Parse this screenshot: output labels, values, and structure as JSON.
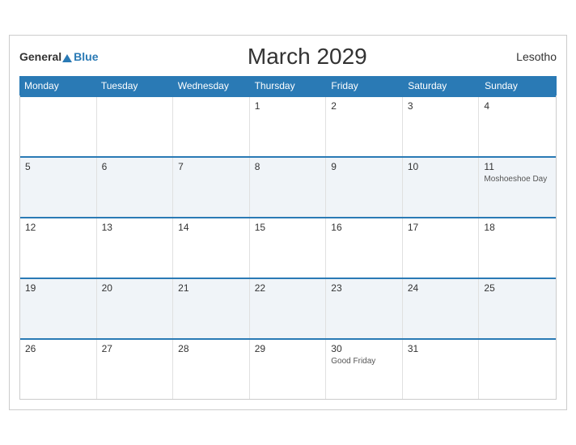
{
  "header": {
    "title": "March 2029",
    "country": "Lesotho",
    "logo_general": "General",
    "logo_blue": "Blue"
  },
  "days_of_week": [
    "Monday",
    "Tuesday",
    "Wednesday",
    "Thursday",
    "Friday",
    "Saturday",
    "Sunday"
  ],
  "weeks": [
    [
      {
        "day": "",
        "holiday": "",
        "empty": true
      },
      {
        "day": "",
        "holiday": "",
        "empty": true
      },
      {
        "day": "",
        "holiday": "",
        "empty": true
      },
      {
        "day": "1",
        "holiday": ""
      },
      {
        "day": "2",
        "holiday": ""
      },
      {
        "day": "3",
        "holiday": ""
      },
      {
        "day": "4",
        "holiday": ""
      }
    ],
    [
      {
        "day": "5",
        "holiday": ""
      },
      {
        "day": "6",
        "holiday": ""
      },
      {
        "day": "7",
        "holiday": ""
      },
      {
        "day": "8",
        "holiday": ""
      },
      {
        "day": "9",
        "holiday": ""
      },
      {
        "day": "10",
        "holiday": ""
      },
      {
        "day": "11",
        "holiday": "Moshoeshoe Day"
      }
    ],
    [
      {
        "day": "12",
        "holiday": ""
      },
      {
        "day": "13",
        "holiday": ""
      },
      {
        "day": "14",
        "holiday": ""
      },
      {
        "day": "15",
        "holiday": ""
      },
      {
        "day": "16",
        "holiday": ""
      },
      {
        "day": "17",
        "holiday": ""
      },
      {
        "day": "18",
        "holiday": ""
      }
    ],
    [
      {
        "day": "19",
        "holiday": ""
      },
      {
        "day": "20",
        "holiday": ""
      },
      {
        "day": "21",
        "holiday": ""
      },
      {
        "day": "22",
        "holiday": ""
      },
      {
        "day": "23",
        "holiday": ""
      },
      {
        "day": "24",
        "holiday": ""
      },
      {
        "day": "25",
        "holiday": ""
      }
    ],
    [
      {
        "day": "26",
        "holiday": ""
      },
      {
        "day": "27",
        "holiday": ""
      },
      {
        "day": "28",
        "holiday": ""
      },
      {
        "day": "29",
        "holiday": ""
      },
      {
        "day": "30",
        "holiday": "Good Friday"
      },
      {
        "day": "31",
        "holiday": ""
      },
      {
        "day": "",
        "holiday": "",
        "empty": true
      }
    ]
  ]
}
